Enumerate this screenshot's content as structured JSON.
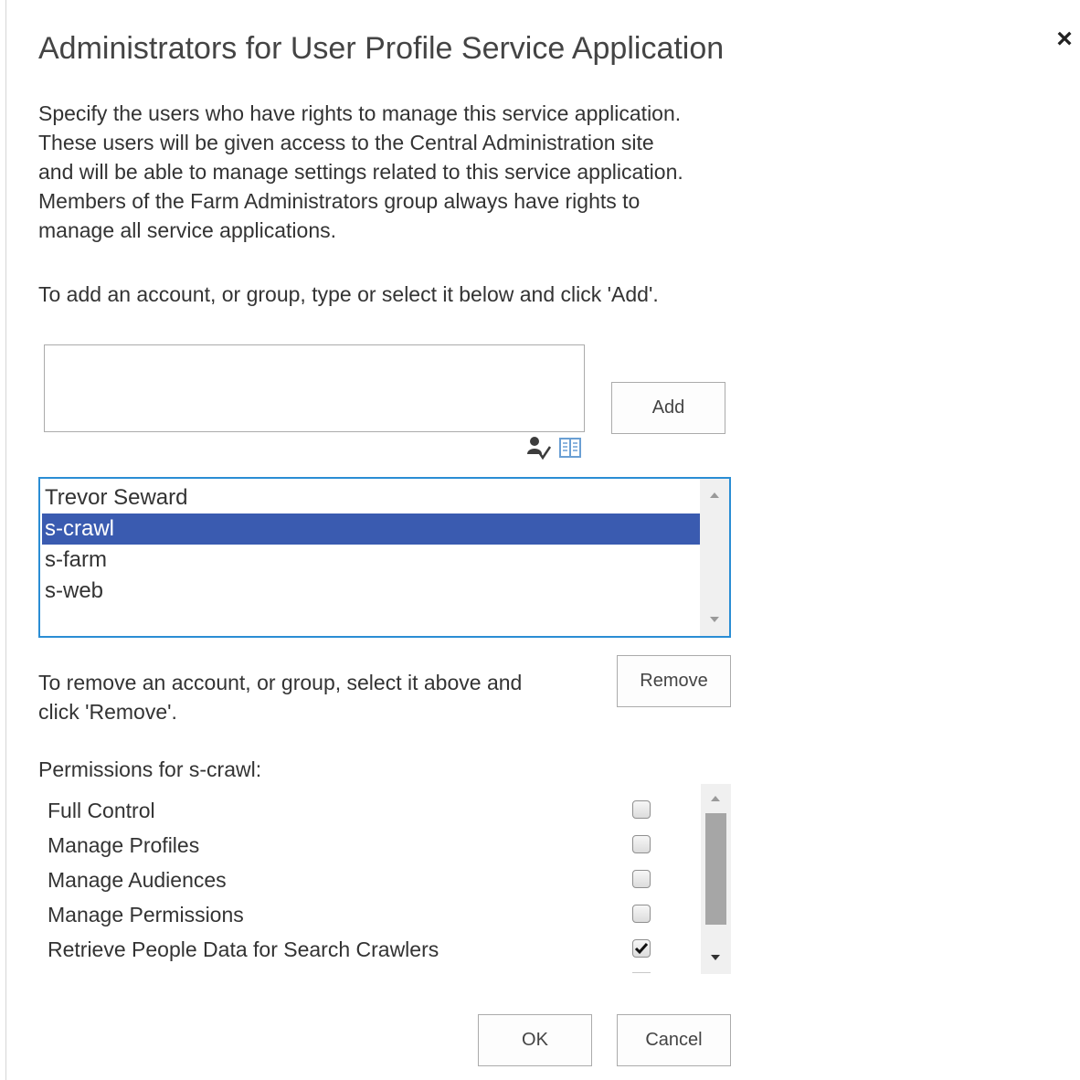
{
  "dialog": {
    "title": "Administrators for User Profile Service Application",
    "close_glyph": "×",
    "description_lines": [
      "Specify the users who have rights to manage this service application.",
      "These users will be given access to the Central Administration site",
      "and will be able to manage settings related to this service application.",
      "Members of the Farm Administrators group always have rights to",
      "manage all service applications."
    ],
    "add_instruction": "To add an account, or group, type or select it below and click 'Add'.",
    "people_input": {
      "value": "",
      "placeholder": ""
    },
    "icons": {
      "check_names": "check-names-icon",
      "browse": "address-book-icon"
    },
    "add_label": "Add",
    "users": [
      {
        "name": "Trevor Seward",
        "selected": false
      },
      {
        "name": "s-crawl",
        "selected": true
      },
      {
        "name": "s-farm",
        "selected": false
      },
      {
        "name": "s-web",
        "selected": false
      }
    ],
    "remove_instruction_lines": [
      "To remove an account, or group, select it above and",
      "click 'Remove'."
    ],
    "remove_label": "Remove",
    "permissions_heading": "Permissions for s-crawl:",
    "permissions": [
      {
        "label": "Full Control",
        "checked": false
      },
      {
        "label": "Manage Profiles",
        "checked": false
      },
      {
        "label": "Manage Audiences",
        "checked": false
      },
      {
        "label": "Manage Permissions",
        "checked": false
      },
      {
        "label": "Retrieve People Data for Search Crawlers",
        "checked": true
      }
    ],
    "ok_label": "OK",
    "cancel_label": "Cancel"
  },
  "colors": {
    "selection": "#3a5bb0",
    "listbox_focus_border": "#2a8dd4",
    "button_border": "#ababab"
  }
}
